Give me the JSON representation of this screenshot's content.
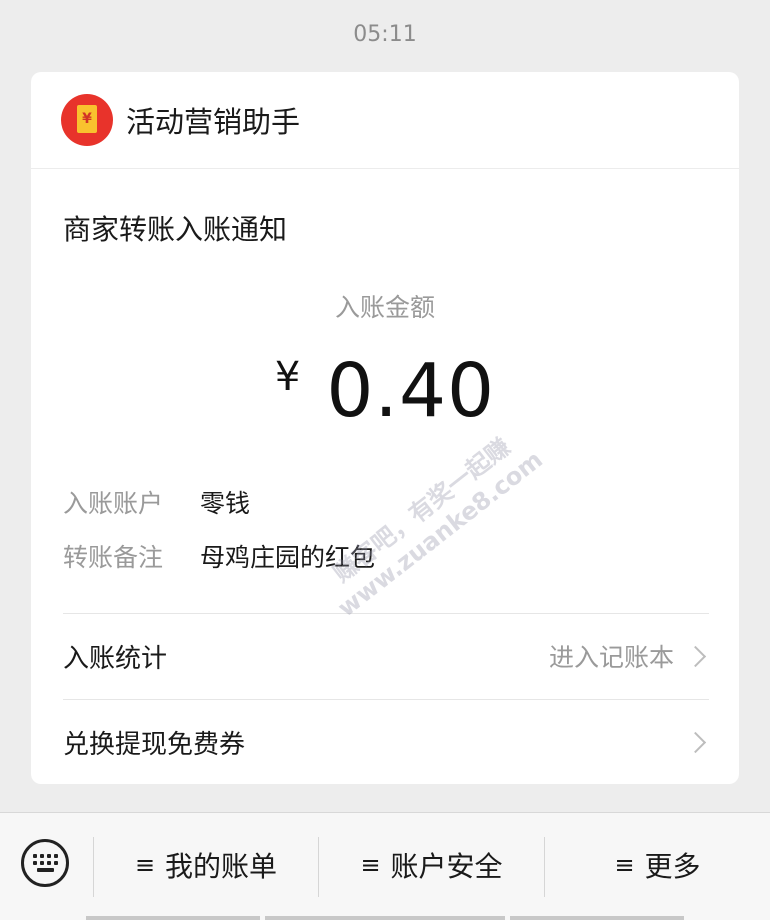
{
  "status": {
    "time": "05:11"
  },
  "service": {
    "name": "活动营销助手",
    "logo_glyph": "¥"
  },
  "notice": {
    "title": "商家转账入账通知",
    "amount_label": "入账金额",
    "currency": "¥",
    "amount": "0.40",
    "details": [
      {
        "key": "入账账户",
        "value": "零钱"
      },
      {
        "key": "转账备注",
        "value": "母鸡庄园的红包"
      }
    ],
    "links": [
      {
        "label": "入账统计",
        "action": "进入记账本"
      },
      {
        "label": "兑换提现免费券",
        "action": ""
      }
    ]
  },
  "watermark": {
    "line1": "赚客吧，有奖一起赚",
    "line2": "www.zuanke8.com"
  },
  "bottom_menu": [
    {
      "icon": "≡",
      "label": "我的账单"
    },
    {
      "icon": "≡",
      "label": "账户安全"
    },
    {
      "icon": "≡",
      "label": "更多"
    }
  ],
  "colors": {
    "brand_red": "#e8332b",
    "envelope_gold": "#f9c22e",
    "background": "#ededed"
  }
}
